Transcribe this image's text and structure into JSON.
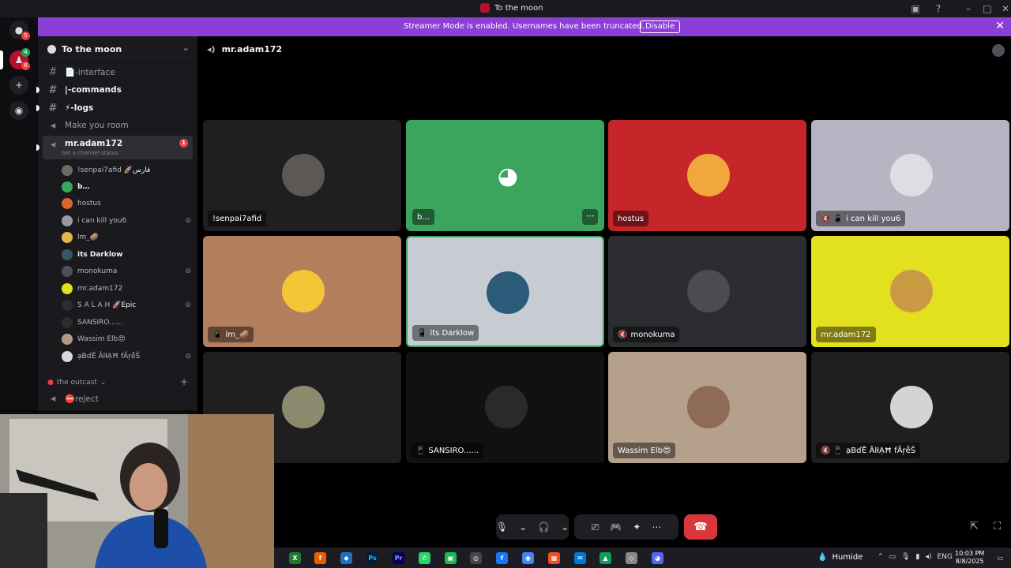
{
  "titlebar": {
    "title": "To the moon"
  },
  "banner": {
    "text": "Streamer Mode is enabled. Usernames have been truncated.",
    "disable_label": "Disable"
  },
  "rail": {
    "badge_top": "5",
    "badge_server": "6",
    "badge_server_top": "4"
  },
  "sidebar": {
    "server_name": "To the moon",
    "channels": [
      {
        "label": "📄-interface"
      },
      {
        "label": "|-commands"
      },
      {
        "label": "⚡-logs"
      },
      {
        "label": "Make you room"
      }
    ],
    "voice_channel": {
      "name": "mr.adam172",
      "status": "Set a channel status",
      "badge": "1"
    },
    "voice_users": [
      {
        "name": "!senpai7afid",
        "tag": "🚀فارس"
      },
      {
        "name": "b…",
        "tag": ""
      },
      {
        "name": "hostus",
        "tag": ""
      },
      {
        "name": "i can kill you6",
        "tag": ""
      },
      {
        "name": "lm_🥔",
        "tag": ""
      },
      {
        "name": "its Darklow",
        "tag": ""
      },
      {
        "name": "monokuma",
        "tag": ""
      },
      {
        "name": "mr.adam172",
        "tag": ""
      },
      {
        "name": "S A L A H",
        "tag": "🚀Epic"
      },
      {
        "name": "SANSIRO......",
        "tag": ""
      },
      {
        "name": "Wassim Elb😍",
        "tag": ""
      },
      {
        "name": "ạBɗĔ ÃlłẠĦ fĂŗễŠ",
        "tag": ""
      }
    ],
    "category": "the outcast",
    "extra_channel": "⛔reject"
  },
  "main": {
    "header": "mr.adam172",
    "tiles": [
      {
        "name": "!senpai7afid",
        "prefix": ""
      },
      {
        "name": "b...",
        "prefix": ""
      },
      {
        "name": "hostus",
        "prefix": ""
      },
      {
        "name": "i can kill you6",
        "prefix": "🔇 📱"
      },
      {
        "name": "lm_🥔",
        "prefix": "📱"
      },
      {
        "name": "its Darklow",
        "prefix": "📱"
      },
      {
        "name": "monokuma",
        "prefix": "🔇"
      },
      {
        "name": "mr.adam172",
        "prefix": ""
      },
      {
        "name": "",
        "prefix": ""
      },
      {
        "name": "SANSIRO......",
        "prefix": "📱"
      },
      {
        "name": "Wassim Elb😍",
        "prefix": ""
      },
      {
        "name": "ạBɗĔ ÃlłẠĦ fĂŗễŠ",
        "prefix": "🔇 📱"
      }
    ]
  },
  "taskbar": {
    "weather": "Humide",
    "lang": "ENG",
    "time": "10:03 PM",
    "date": "8/8/2025"
  },
  "colors": {
    "accent": "#8c3fd6",
    "speaking": "#3ba55d",
    "hangup": "#da373c"
  }
}
